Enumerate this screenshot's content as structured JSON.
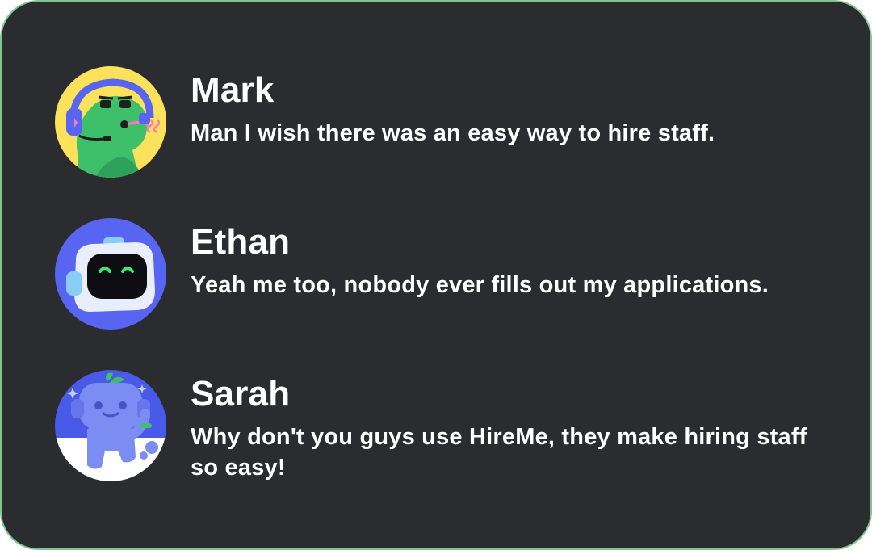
{
  "colors": {
    "card_background": "#2b2c30",
    "card_border": "#7fc48a",
    "text": "#ffffff"
  },
  "messages": [
    {
      "name": "Mark",
      "text": "Man I wish there was an easy way to hire staff.",
      "avatar": "green-character-headset-avatar-icon"
    },
    {
      "name": "Ethan",
      "text": "Yeah me too, nobody ever fills out my applications.",
      "avatar": "robot-avatar-icon"
    },
    {
      "name": "Sarah",
      "text": "Why don't you guys use HireMe, they make hiring staff so easy!",
      "avatar": "blue-bot-mascot-avatar-icon"
    }
  ]
}
